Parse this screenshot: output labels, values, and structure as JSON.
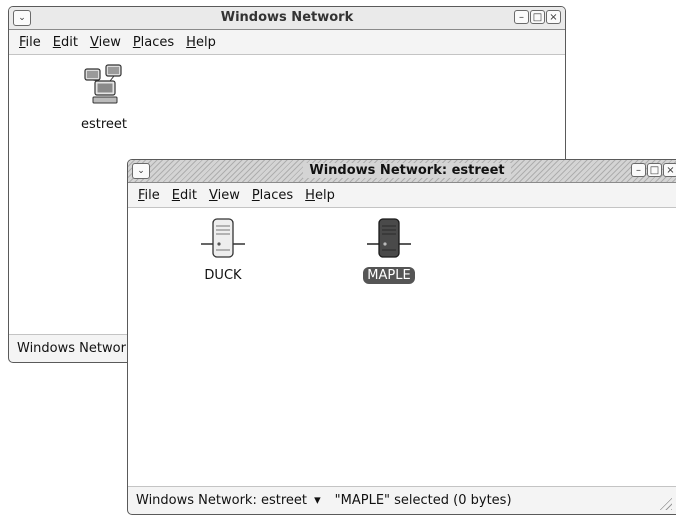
{
  "back_window": {
    "title": "Windows Network",
    "menu": [
      {
        "accel": "F",
        "rest": "ile"
      },
      {
        "accel": "E",
        "rest": "dit"
      },
      {
        "accel": "V",
        "rest": "iew"
      },
      {
        "accel": "P",
        "rest": "laces"
      },
      {
        "accel": "H",
        "rest": "elp"
      }
    ],
    "icons": [
      {
        "label": "estreet",
        "icon": "workgroup-network-icon"
      }
    ],
    "status": "Windows Network"
  },
  "front_window": {
    "title": "Windows Network: estreet",
    "menu": [
      {
        "accel": "F",
        "rest": "ile"
      },
      {
        "accel": "E",
        "rest": "dit"
      },
      {
        "accel": "V",
        "rest": "iew"
      },
      {
        "accel": "P",
        "rest": "laces"
      },
      {
        "accel": "H",
        "rest": "elp"
      }
    ],
    "icons": [
      {
        "label": "DUCK",
        "icon": "server-icon",
        "selected": false
      },
      {
        "label": "MAPLE",
        "icon": "server-icon",
        "selected": true
      }
    ],
    "status_location": "Windows Network: estreet",
    "status_dropdown_icon": "▾",
    "status_info": "\"MAPLE\" selected (0 bytes)"
  },
  "window_controls": {
    "menu_glyph": "⌄",
    "minimize_glyph": "–",
    "maximize_glyph": "□",
    "close_glyph": "×"
  }
}
